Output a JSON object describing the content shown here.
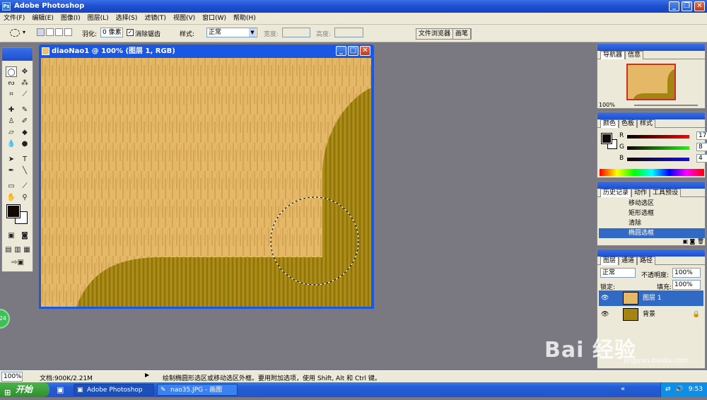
{
  "app_title": "Adobe Photoshop",
  "menu": [
    "文件(F)",
    "编辑(E)",
    "图像(I)",
    "图层(L)",
    "选择(S)",
    "滤镜(T)",
    "视图(V)",
    "窗口(W)",
    "帮助(H)"
  ],
  "options": {
    "feather_label": "羽化:",
    "feather_value": "0 像素",
    "antialias_label": "消除锯齿",
    "style_label": "样式:",
    "style_value": "正常",
    "width_label": "宽度:",
    "height_label": "高度:"
  },
  "palette_well": [
    "文件浏览器",
    "画笔"
  ],
  "document": {
    "title": "diaoNao1 @ 100% (图层 1, RGB)"
  },
  "navigator": {
    "tabs": [
      "导航器",
      "信息"
    ],
    "zoom": "100%"
  },
  "color": {
    "tabs": [
      "颜色",
      "色板",
      "样式"
    ],
    "r_label": "R",
    "r_value": "17",
    "g_label": "G",
    "g_value": "8",
    "b_label": "B",
    "b_value": "4",
    "foreground": "#110804"
  },
  "history": {
    "tabs": [
      "历史记录",
      "动作",
      "工具预设"
    ],
    "items": [
      "移动选区",
      "矩形选框",
      "清除",
      "椭圆选框"
    ]
  },
  "layers": {
    "tabs": [
      "图层",
      "通道",
      "路径"
    ],
    "blend_mode": "正常",
    "opacity_label": "不透明度:",
    "opacity_value": "100%",
    "lock_label": "锁定:",
    "fill_label": "填充:",
    "fill_value": "100%",
    "items": [
      "图层 1",
      "背景"
    ]
  },
  "status": {
    "zoom": "100%",
    "doc_size": "文档:900K/2.21M",
    "hint": "绘制椭圆形选区或移动选区外框。要用附加选项，使用 Shift, Alt 和 Ctrl 键。"
  },
  "taskbar": {
    "start": "开始",
    "tasks": [
      "Adobe Photoshop",
      "nao35.JPG - 画图"
    ],
    "clock": "9:53"
  },
  "watermark": {
    "brand": "Bai 经验",
    "url": "jingyan.baidu.com"
  },
  "side_badge": "24"
}
